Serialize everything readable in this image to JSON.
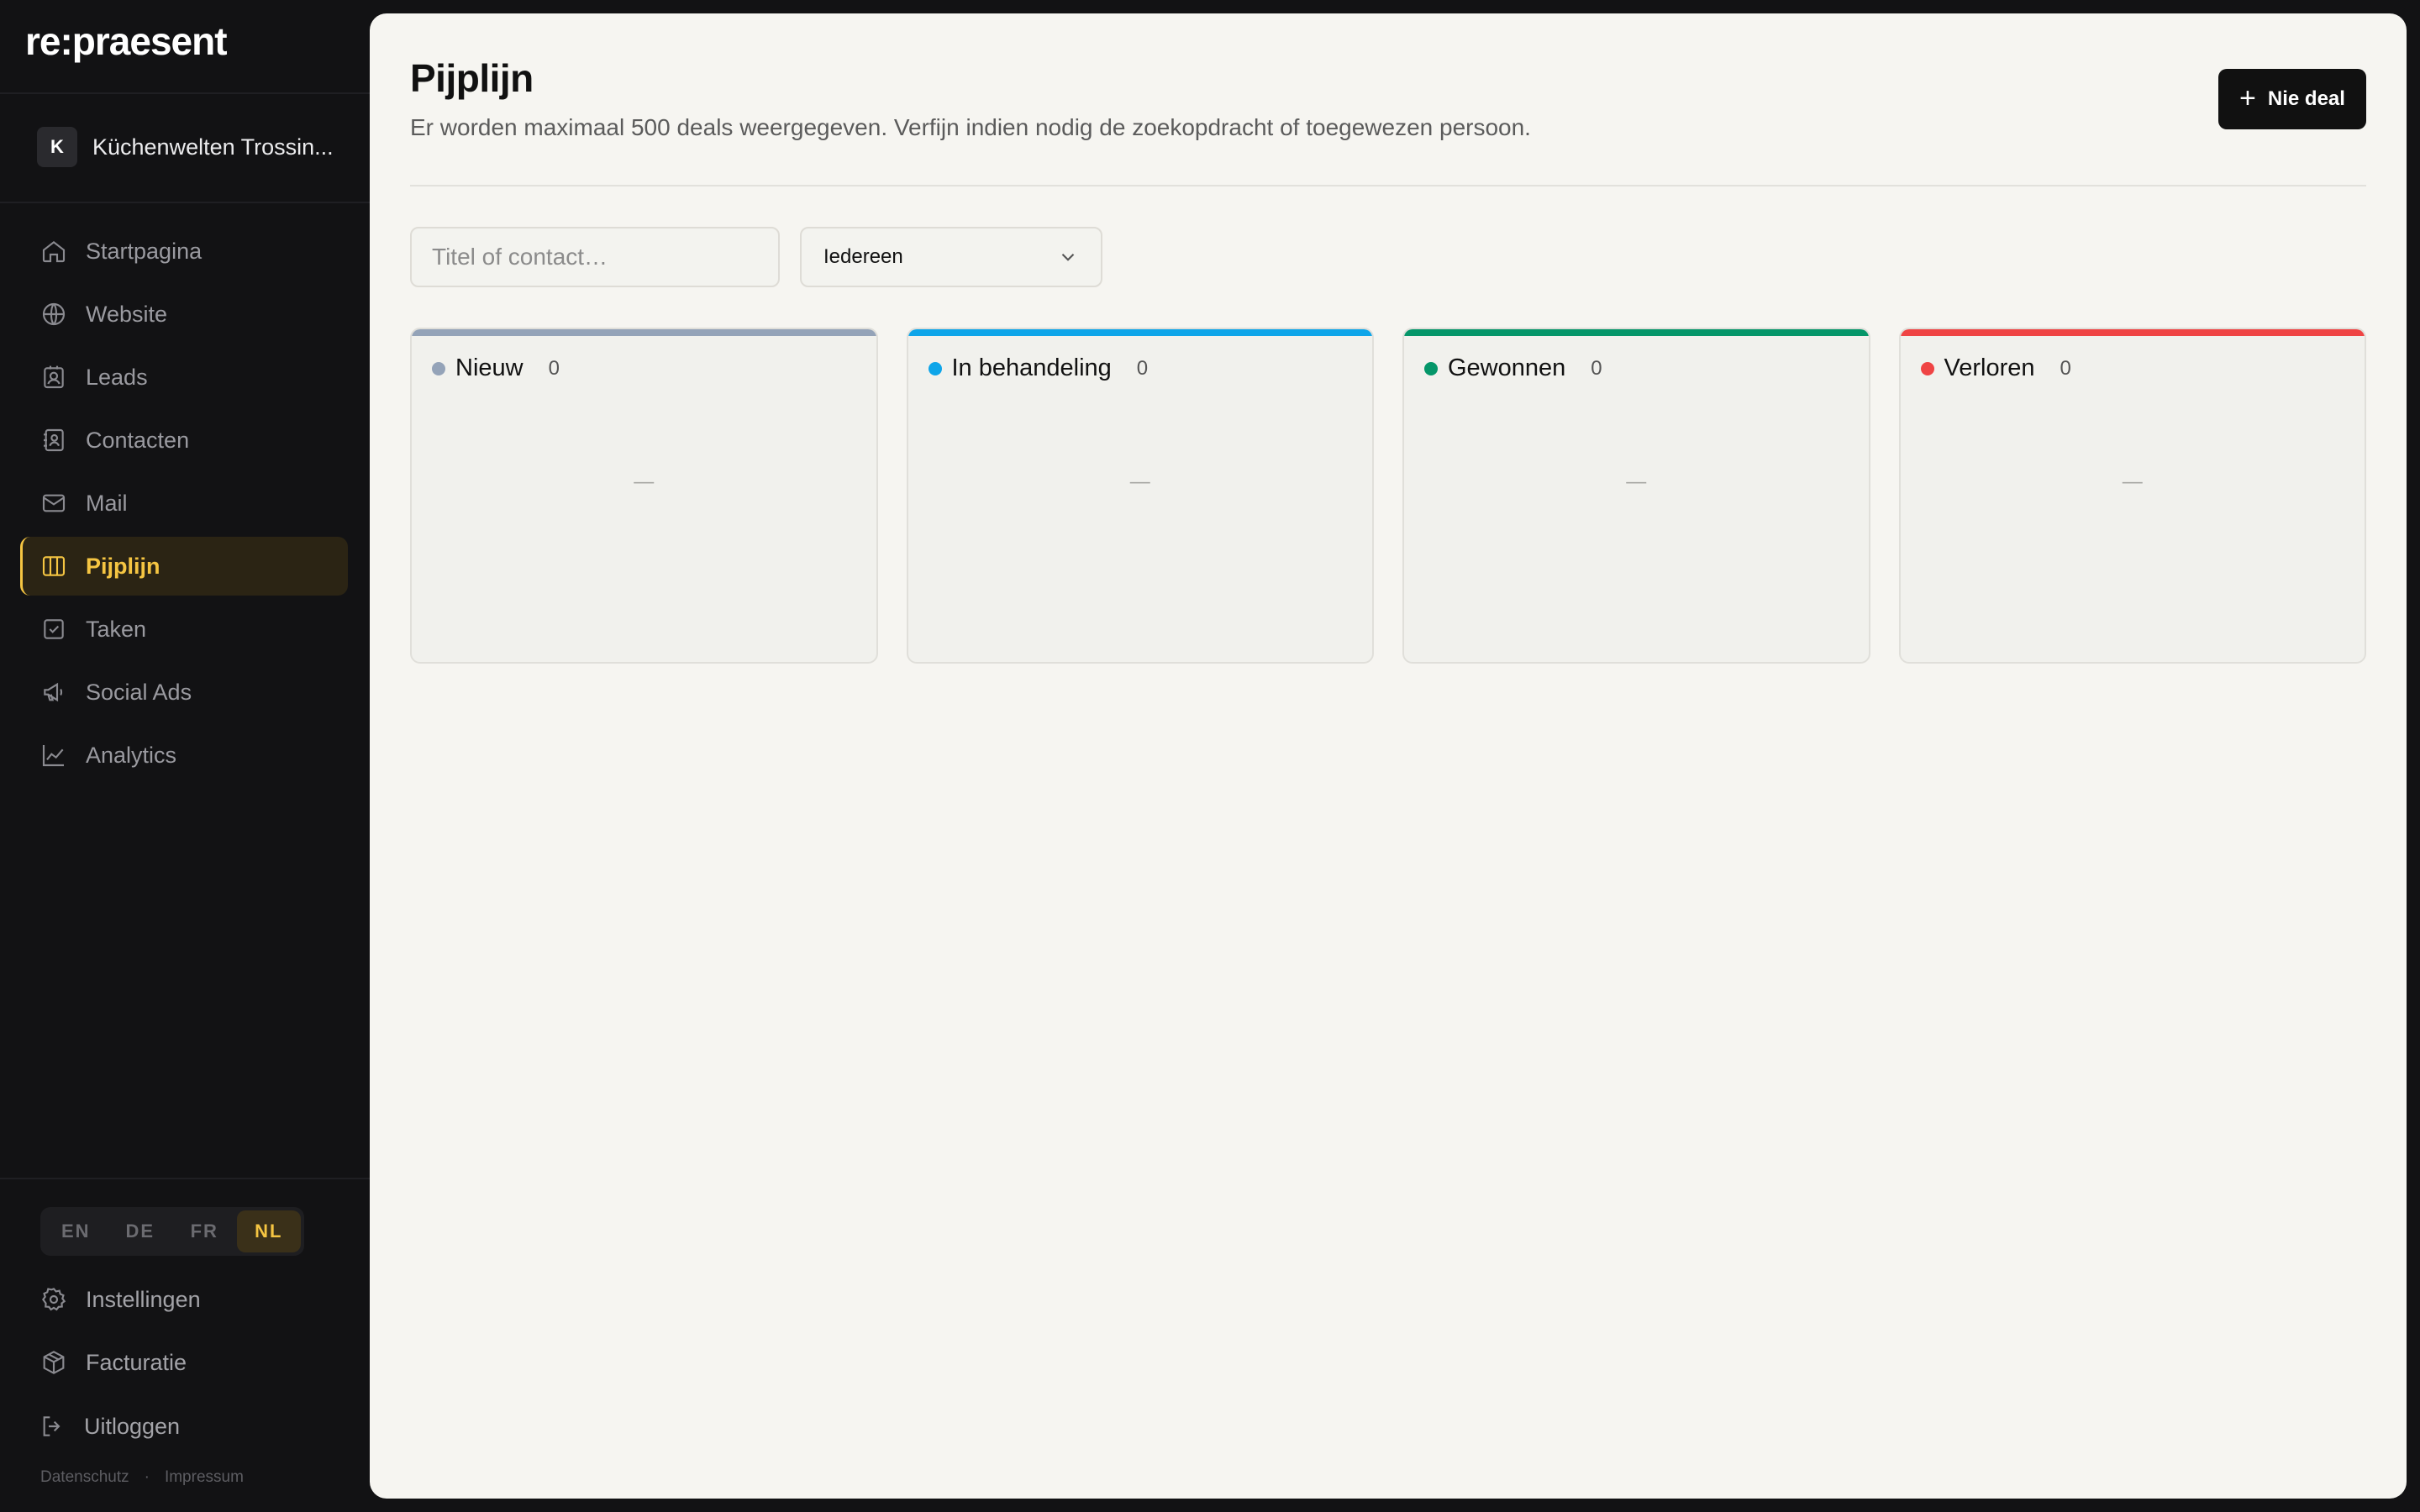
{
  "app": {
    "logo": "re:praesent"
  },
  "org": {
    "initial": "K",
    "name": "Küchenwelten Trossin..."
  },
  "nav": {
    "items": [
      {
        "label": "Startpagina",
        "icon": "home-icon"
      },
      {
        "label": "Website",
        "icon": "globe-icon"
      },
      {
        "label": "Leads",
        "icon": "leads-icon"
      },
      {
        "label": "Contacten",
        "icon": "contact-book-icon"
      },
      {
        "label": "Mail",
        "icon": "mail-icon"
      },
      {
        "label": "Pijplijn",
        "icon": "kanban-icon",
        "active": true
      },
      {
        "label": "Taken",
        "icon": "checkbox-icon"
      },
      {
        "label": "Social Ads",
        "icon": "megaphone-icon"
      },
      {
        "label": "Analytics",
        "icon": "chart-line-icon"
      }
    ]
  },
  "languages": [
    {
      "code": "EN"
    },
    {
      "code": "DE"
    },
    {
      "code": "FR"
    },
    {
      "code": "NL",
      "active": true
    }
  ],
  "bottom": {
    "settings": "Instellingen",
    "billing": "Facturatie",
    "logout": "Uitloggen"
  },
  "footer": {
    "privacy": "Datenschutz",
    "separator": "·",
    "imprint": "Impressum"
  },
  "page": {
    "title": "Pijplijn",
    "subtitle": "Er worden maximaal 500 deals weergegeven. Verfijn indien nodig de zoekopdracht of toegewezen persoon.",
    "new_deal_label": "Nie deal"
  },
  "filters": {
    "search_placeholder": "Titel of contact…",
    "assignee_selected": "Iedereen"
  },
  "columns": [
    {
      "title": "Nieuw",
      "count": "0",
      "color": "#94a3b8",
      "empty": "—"
    },
    {
      "title": "In behandeling",
      "count": "0",
      "color": "#0ea5e9",
      "empty": "—"
    },
    {
      "title": "Gewonnen",
      "count": "0",
      "color": "#059669",
      "empty": "—"
    },
    {
      "title": "Verloren",
      "count": "0",
      "color": "#ef4444",
      "empty": "—"
    }
  ],
  "colors": {
    "accent": "#f5c542",
    "sidebar_bg": "#121214",
    "main_bg": "#f6f5f1"
  }
}
